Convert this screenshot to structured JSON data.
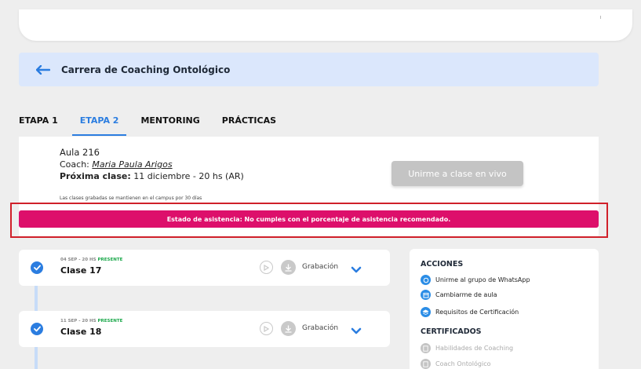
{
  "course": {
    "title": "Carrera de Coaching Ontológico"
  },
  "tabs": [
    {
      "label": "ETAPA 1",
      "active": false
    },
    {
      "label": "ETAPA 2",
      "active": true
    },
    {
      "label": "MENTORING",
      "active": false
    },
    {
      "label": "PRÁCTICAS",
      "active": false
    }
  ],
  "aula": {
    "name": "Aula 216",
    "coach_prefix": "Coach: ",
    "coach_name": "Maria Paula Arigos",
    "next_prefix": "Próxima clase:",
    "next_value": " 11 diciembre - 20 hs (AR)",
    "recorded_note": "Las clases grabadas se mantienen en el campus por 30 días",
    "live_button": "Unirme a clase en vivo"
  },
  "attendance": {
    "text": "Estado de asistencia: No cumples con el porcentaje de asistencia recomendado."
  },
  "classes": [
    {
      "meta": "04 SEP - 20 HS ",
      "status": "PRESENTE",
      "title": "Clase 17",
      "recording_label": "Grabación"
    },
    {
      "meta": "11 SEP - 20 HS ",
      "status": "PRESENTE",
      "title": "Clase 18",
      "recording_label": "Grabación"
    }
  ],
  "sidebar": {
    "actions_heading": "ACCIONES",
    "actions": [
      {
        "label": "Unirme al grupo de WhatsApp",
        "icon": "whatsapp-icon"
      },
      {
        "label": "Cambiarme de aula",
        "icon": "calendar-icon"
      },
      {
        "label": "Requisitos de Certificación",
        "icon": "graduation-cap-icon"
      }
    ],
    "certificates_heading": "CERTIFICADOS",
    "certificates": [
      {
        "label": "Habilidades de Coaching",
        "icon": "certificate-icon"
      },
      {
        "label": "Coach Ontológico",
        "icon": "certificate-icon"
      }
    ]
  },
  "colors": {
    "accent": "#2b7de0",
    "alert": "#dd0f6b",
    "present": "#1aa84a",
    "highlight_border": "#d0202a"
  }
}
